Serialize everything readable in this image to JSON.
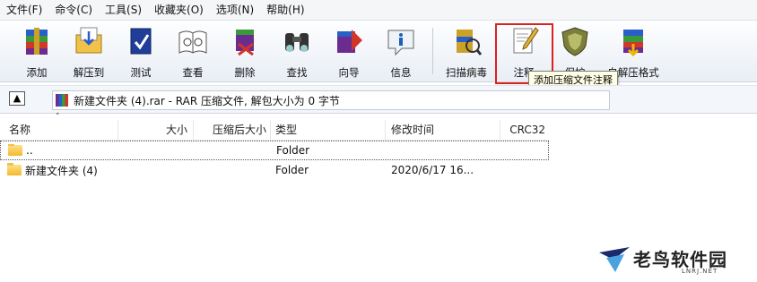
{
  "menubar": [
    "文件(F)",
    "命令(C)",
    "工具(S)",
    "收藏夹(O)",
    "选项(N)",
    "帮助(H)"
  ],
  "toolbar": [
    {
      "label": "添加",
      "icon": "add-archive-icon"
    },
    {
      "label": "解压到",
      "icon": "extract-to-icon"
    },
    {
      "label": "测试",
      "icon": "test-icon"
    },
    {
      "label": "查看",
      "icon": "view-icon"
    },
    {
      "label": "删除",
      "icon": "delete-icon"
    },
    {
      "label": "查找",
      "icon": "find-icon"
    },
    {
      "label": "向导",
      "icon": "wizard-icon"
    },
    {
      "label": "信息",
      "icon": "info-icon"
    },
    {
      "label": "扫描病毒",
      "icon": "virus-scan-icon"
    },
    {
      "label": "注释",
      "icon": "comment-icon"
    },
    {
      "label": "保护",
      "icon": "protect-icon"
    },
    {
      "label": "自解压格式",
      "icon": "sfx-icon"
    }
  ],
  "tooltip": "添加压缩文件注释",
  "pathbar": {
    "text": "新建文件夹 (4).rar - RAR 压缩文件, 解包大小为 0 字节"
  },
  "columns": {
    "name": "名称",
    "size": "大小",
    "packed": "压缩后大小",
    "type": "类型",
    "mtime": "修改时间",
    "crc": "CRC32"
  },
  "files": [
    {
      "name": "..",
      "type": "Folder",
      "mtime": ""
    },
    {
      "name": "新建文件夹 (4)",
      "type": "Folder",
      "mtime": "2020/6/17 16..."
    }
  ],
  "watermark": {
    "text": "老鸟软件园",
    "sub": "LNRJ.NET"
  },
  "colors": {
    "highlight": "#d9231f"
  }
}
